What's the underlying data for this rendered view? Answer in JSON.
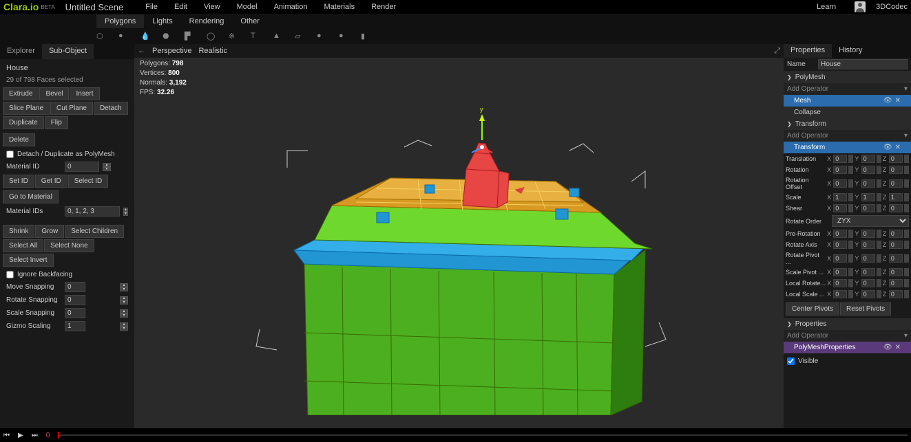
{
  "app": {
    "logo": "Clara.io",
    "beta": "BETA",
    "scene": "Untitled Scene"
  },
  "topMenu": [
    "File",
    "Edit",
    "View",
    "Model",
    "Animation",
    "Materials",
    "Render"
  ],
  "topRight": {
    "learn": "Learn",
    "user": "3DCodec"
  },
  "subTabs": [
    "Polygons",
    "Lights",
    "Rendering",
    "Other"
  ],
  "leftTabs": [
    "Explorer",
    "Sub-Object"
  ],
  "leftPanel": {
    "objectName": "House",
    "selection": "29 of 798 Faces selected",
    "row1": [
      "Extrude",
      "Bevel",
      "Insert"
    ],
    "row2": [
      "Slice Plane",
      "Cut Plane",
      "Detach"
    ],
    "row3": [
      "Duplicate",
      "Flip"
    ],
    "delete": "Delete",
    "detachPoly": "Detach / Duplicate as PolyMesh",
    "materialId": {
      "label": "Material ID",
      "value": "0"
    },
    "idRow": [
      "Set ID",
      "Get ID",
      "Select ID"
    ],
    "gotoMat": "Go to Material",
    "matIds": {
      "label": "Material IDs",
      "value": "0, 1, 2, 3"
    },
    "sizeRow": [
      "Shrink",
      "Grow",
      "Select Children"
    ],
    "selRow": [
      "Select All",
      "Select None"
    ],
    "selInvert": "Select Invert",
    "ignoreBack": "Ignore Backfacing",
    "moveSnap": {
      "label": "Move Snapping",
      "value": "0"
    },
    "rotSnap": {
      "label": "Rotate Snapping",
      "value": "0"
    },
    "scaleSnap": {
      "label": "Scale Snapping",
      "value": "0"
    },
    "gizmo": {
      "label": "Gizmo Scaling",
      "value": "1"
    }
  },
  "viewport": {
    "mode1": "Perspective",
    "mode2": "Realistic",
    "stats": {
      "polygons": {
        "label": "Polygons:",
        "value": "798"
      },
      "vertices": {
        "label": "Vertices:",
        "value": "800"
      },
      "normals": {
        "label": "Normals:",
        "value": "3,192"
      },
      "fps": {
        "label": "FPS:",
        "value": "32.26"
      }
    }
  },
  "rightTabs": [
    "Properties",
    "History"
  ],
  "right": {
    "nameLabel": "Name",
    "nameValue": "House",
    "polyMesh": "PolyMesh",
    "addOp": "Add Operator",
    "mesh": "Mesh",
    "collapse": "Collapse",
    "transform": "Transform",
    "transformOp": "Transform",
    "translation": "Translation",
    "rotation": "Rotation",
    "rotOffset": "Rotation Offset",
    "scale": "Scale",
    "shear": "Shear",
    "rotOrder": {
      "label": "Rotate Order",
      "value": "ZYX"
    },
    "preRot": "Pre-Rotation",
    "rotAxis": "Rotate Axis",
    "rotPivot": "Rotate Pivot ...",
    "scalePivot": "Scale Pivot ...",
    "localRotate": "Local Rotate...",
    "localScale": "Local Scale ...",
    "centerPivots": "Center Pivots",
    "resetPivots": "Reset Pivots",
    "properties": "Properties",
    "polyProps": "PolyMeshProperties",
    "visible": "Visible",
    "x": "X",
    "y": "Y",
    "z": "Z",
    "v0": "0",
    "v1": "1"
  },
  "timeline": {
    "frame": "0"
  }
}
